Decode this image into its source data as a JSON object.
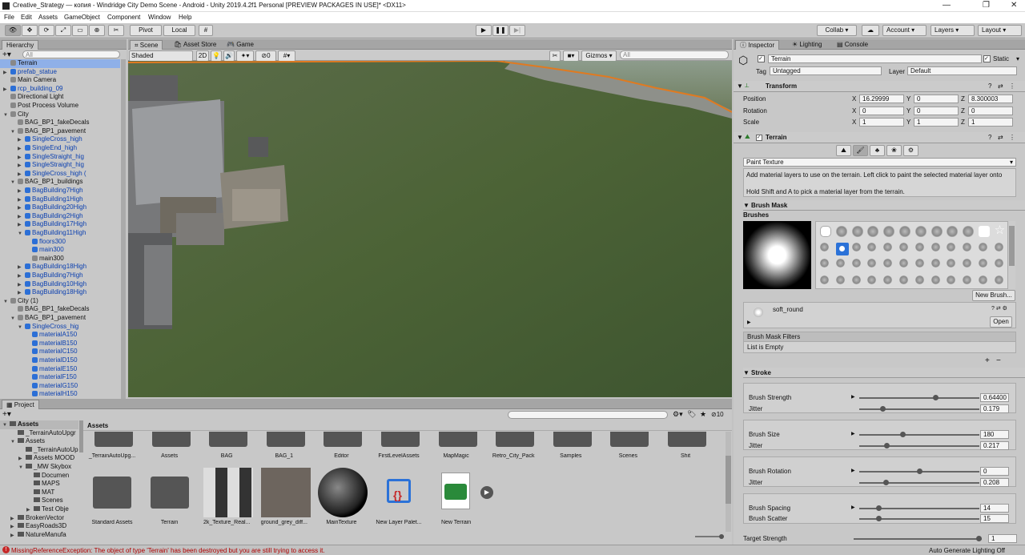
{
  "window": {
    "title": "Creative_Strategy — копия - Windridge City Demo Scene - Android - Unity 2019.4.2f1 Personal [PREVIEW PACKAGES IN USE]* <DX11>"
  },
  "menu": [
    "File",
    "Edit",
    "Assets",
    "GameObject",
    "Component",
    "Window",
    "Help"
  ],
  "toolbar": {
    "pivot": "Pivot",
    "local": "Local",
    "collab": "Collab ▾",
    "account": "Account",
    "layers": "Layers",
    "layout": "Layout"
  },
  "hierarchy": {
    "tab": "Hierarchy",
    "search_placeholder": "All",
    "items": [
      {
        "label": "Terrain",
        "indent": 2,
        "color": "black",
        "cube": "gray",
        "selected": true
      },
      {
        "label": "prefab_statue",
        "indent": 2,
        "color": "blue",
        "cube": "blue",
        "arrow": "▶"
      },
      {
        "label": "Main Camera",
        "indent": 2,
        "color": "black",
        "cube": "gray"
      },
      {
        "label": "rcp_building_09",
        "indent": 2,
        "color": "blue",
        "cube": "blue",
        "arrow": "▶"
      },
      {
        "label": "Directional Light",
        "indent": 2,
        "color": "black",
        "cube": "gray"
      },
      {
        "label": "Post Process Volume",
        "indent": 2,
        "color": "black",
        "cube": "gray"
      },
      {
        "label": "City",
        "indent": 2,
        "color": "black",
        "cube": "gray",
        "arrow": "▼"
      },
      {
        "label": "BAG_BP1_fakeDecals",
        "indent": 3,
        "color": "black",
        "cube": "gray"
      },
      {
        "label": "BAG_BP1_pavement",
        "indent": 3,
        "color": "black",
        "cube": "gray",
        "arrow": "▼"
      },
      {
        "label": "SingleCross_high",
        "indent": 4,
        "color": "blue",
        "cube": "blue",
        "arrow": "▶"
      },
      {
        "label": "SingleEnd_high",
        "indent": 4,
        "color": "blue",
        "cube": "blue",
        "arrow": "▶"
      },
      {
        "label": "SingleStraight_hig",
        "indent": 4,
        "color": "blue",
        "cube": "blue",
        "arrow": "▶"
      },
      {
        "label": "SingleStraight_hig",
        "indent": 4,
        "color": "blue",
        "cube": "blue",
        "arrow": "▶"
      },
      {
        "label": "SingleCross_high (",
        "indent": 4,
        "color": "blue",
        "cube": "blue",
        "arrow": "▶"
      },
      {
        "label": "BAG_BP1_buildings",
        "indent": 3,
        "color": "black",
        "cube": "gray",
        "arrow": "▼"
      },
      {
        "label": "BagBuilding7High",
        "indent": 4,
        "color": "blue",
        "cube": "blue",
        "arrow": "▶"
      },
      {
        "label": "BagBuilding1High",
        "indent": 4,
        "color": "blue",
        "cube": "blue",
        "arrow": "▶"
      },
      {
        "label": "BagBuilding20High",
        "indent": 4,
        "color": "blue",
        "cube": "blue",
        "arrow": "▶"
      },
      {
        "label": "BagBuilding2High",
        "indent": 4,
        "color": "blue",
        "cube": "blue",
        "arrow": "▶"
      },
      {
        "label": "BagBuilding17High",
        "indent": 4,
        "color": "blue",
        "cube": "blue",
        "arrow": "▶"
      },
      {
        "label": "BagBuilding11High",
        "indent": 4,
        "color": "blue",
        "cube": "blue",
        "arrow": "▼"
      },
      {
        "label": "floors300",
        "indent": 5,
        "color": "blue",
        "cube": "blue"
      },
      {
        "label": "main300",
        "indent": 5,
        "color": "blue",
        "cube": "blue"
      },
      {
        "label": "main300",
        "indent": 5,
        "color": "black",
        "cube": "gray"
      },
      {
        "label": "BagBuilding18High",
        "indent": 4,
        "color": "blue",
        "cube": "blue",
        "arrow": "▶"
      },
      {
        "label": "BagBuilding7High",
        "indent": 4,
        "color": "blue",
        "cube": "blue",
        "arrow": "▶"
      },
      {
        "label": "BagBuilding10High",
        "indent": 4,
        "color": "blue",
        "cube": "blue",
        "arrow": "▶"
      },
      {
        "label": "BagBuilding18High",
        "indent": 4,
        "color": "blue",
        "cube": "blue",
        "arrow": "▶"
      },
      {
        "label": "City (1)",
        "indent": 2,
        "color": "black",
        "cube": "gray",
        "arrow": "▼"
      },
      {
        "label": "BAG_BP1_fakeDecals",
        "indent": 3,
        "color": "black",
        "cube": "gray"
      },
      {
        "label": "BAG_BP1_pavement",
        "indent": 3,
        "color": "black",
        "cube": "gray",
        "arrow": "▼"
      },
      {
        "label": "SingleCross_hig",
        "indent": 4,
        "color": "blue",
        "cube": "blue",
        "arrow": "▼"
      },
      {
        "label": "materialA150",
        "indent": 5,
        "color": "blue",
        "cube": "blue"
      },
      {
        "label": "materialB150",
        "indent": 5,
        "color": "blue",
        "cube": "blue"
      },
      {
        "label": "materialC150",
        "indent": 5,
        "color": "blue",
        "cube": "blue"
      },
      {
        "label": "materialD150",
        "indent": 5,
        "color": "blue",
        "cube": "blue"
      },
      {
        "label": "materialE150",
        "indent": 5,
        "color": "blue",
        "cube": "blue"
      },
      {
        "label": "materialF150",
        "indent": 5,
        "color": "blue",
        "cube": "blue"
      },
      {
        "label": "materialG150",
        "indent": 5,
        "color": "blue",
        "cube": "blue"
      },
      {
        "label": "materialH150",
        "indent": 5,
        "color": "blue",
        "cube": "blue"
      }
    ]
  },
  "scene": {
    "tabs": [
      "Scene",
      "Asset Store",
      "Game"
    ],
    "shading": "Shaded",
    "mode2d": "2D",
    "fx_count": "0",
    "gizmos": "Gizmos",
    "search_placeholder": "All"
  },
  "inspector": {
    "tabs": [
      "Inspector",
      "Lighting",
      "Console"
    ],
    "object_name": "Terrain",
    "static_label": "Static",
    "tag_label": "Tag",
    "tag_value": "Untagged",
    "layer_label": "Layer",
    "layer_value": "Default",
    "transform": {
      "title": "Transform",
      "rows": [
        {
          "label": "Position",
          "x": "16.29999",
          "y": "0",
          "z": "8.300003"
        },
        {
          "label": "Rotation",
          "x": "0",
          "y": "0",
          "z": "0"
        },
        {
          "label": "Scale",
          "x": "1",
          "y": "1",
          "z": "1"
        }
      ]
    },
    "terrain": {
      "title": "Terrain",
      "tool": "Paint Texture",
      "help1": "Add material layers to use on the terrain. Left click to paint the selected material layer onto",
      "help2": "Hold Shift and A to pick a material layer from the terrain.",
      "brush_mask": "Brush Mask",
      "brushes": "Brushes",
      "new_brush": "New Brush...",
      "brush_name": "soft_round",
      "open": "Open",
      "filters_title": "Brush Mask Filters",
      "filters_empty": "List is Empty",
      "stroke": "Stroke",
      "params": [
        {
          "label": "Brush Strength",
          "value": "0.64400",
          "level": 0.644
        },
        {
          "label": "Jitter",
          "value": "0.179",
          "level": 0.179
        },
        {
          "label": "Brush Size",
          "value": "180",
          "level": 0.36
        },
        {
          "label": "Jitter",
          "value": "0.217",
          "level": 0.217
        },
        {
          "label": "Brush Rotation",
          "value": "0",
          "level": 0.5
        },
        {
          "label": "Jitter",
          "value": "0.208",
          "level": 0.208
        },
        {
          "label": "Brush Spacing",
          "value": "14",
          "level": 0.15
        },
        {
          "label": "Brush Scatter",
          "value": "15",
          "level": 0.15
        },
        {
          "label": "Target Strength",
          "value": "1",
          "level": 1.0
        }
      ]
    }
  },
  "project": {
    "tab": "Project",
    "breadcrumb": "Assets",
    "item_count": "10",
    "tree": [
      {
        "label": "Assets",
        "indent": 0,
        "arrow": "▼",
        "bold": true
      },
      {
        "label": "_TerrainAutoUpgr",
        "indent": 1
      },
      {
        "label": "Assets",
        "indent": 1,
        "arrow": "▼"
      },
      {
        "label": "_TerrainAutoUpgr",
        "indent": 2
      },
      {
        "label": "Assets MOOD",
        "indent": 2,
        "arrow": "▶"
      },
      {
        "label": "_MW Skybox",
        "indent": 2,
        "arrow": "▼"
      },
      {
        "label": "Documen",
        "indent": 3
      },
      {
        "label": "MAPS",
        "indent": 3
      },
      {
        "label": "MAT",
        "indent": 3
      },
      {
        "label": "Scenes",
        "indent": 3
      },
      {
        "label": "Test Obje",
        "indent": 3,
        "arrow": "▶"
      },
      {
        "label": "BrokenVector",
        "indent": 1,
        "arrow": "▶"
      },
      {
        "label": "EasyRoads3D",
        "indent": 1,
        "arrow": "▶"
      },
      {
        "label": "NatureManufa",
        "indent": 1,
        "arrow": "▶"
      }
    ],
    "row1": [
      "_TerrainAutoUpg...",
      "Assets",
      "BAG",
      "BAG_1",
      "Editor",
      "FirstLevelAssets",
      "MapMagic",
      "Retro_City_Pack",
      "Samples",
      "Scenes",
      "Shit"
    ],
    "row2": [
      "Standard Assets",
      "Terrain",
      "2k_Texture_Real...",
      "ground_grey_diff...",
      "MainTexture",
      "New Layer Palet...",
      "New Terrain"
    ]
  },
  "status": {
    "error": "MissingReferenceException: The object of type 'Terrain' has been destroyed but you are still trying to access it.",
    "right": "Auto Generate Lighting Off"
  }
}
